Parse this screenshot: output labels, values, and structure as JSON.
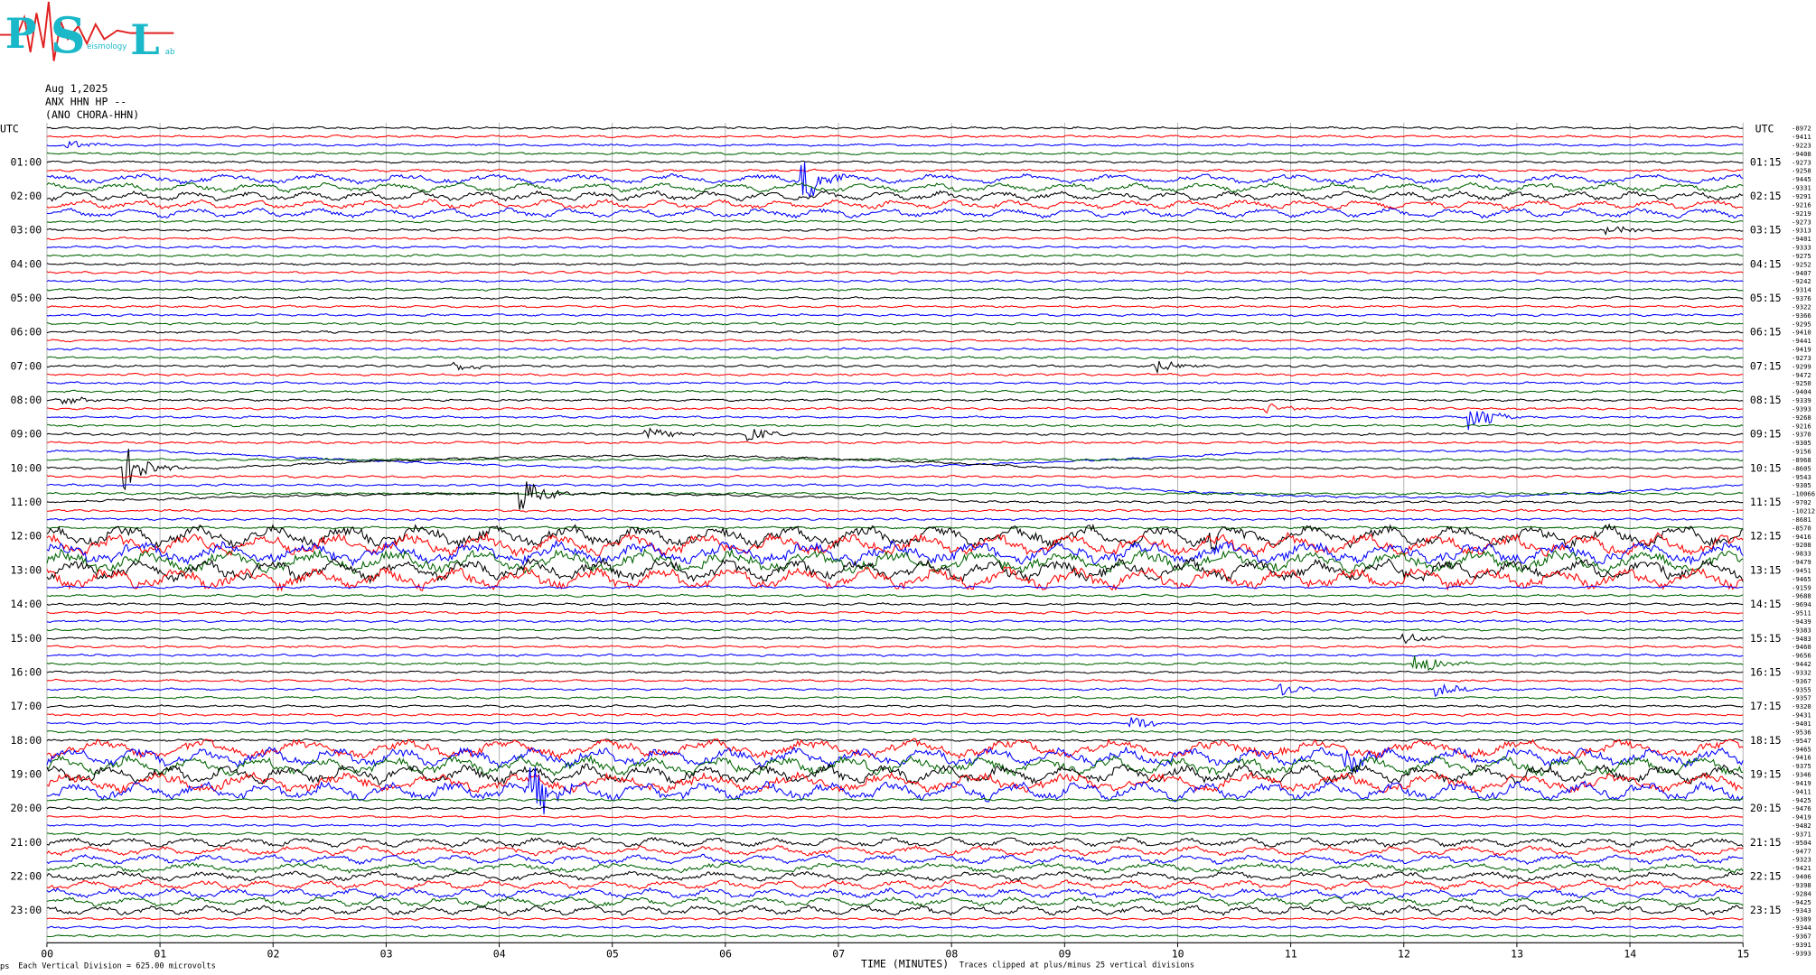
{
  "header": {
    "date": "Aug 1,2025",
    "station": "ANX HHN HP --",
    "location": "(ANO CHORA-HHN)"
  },
  "logo": {
    "letters": [
      "P",
      "S",
      "L"
    ],
    "words": [
      "eismology",
      "ab"
    ],
    "color": "#1ab8c8",
    "wave_color": "#e02020"
  },
  "footer": {
    "scale": "Each Vertical Division =  625.00 microvolts",
    "xlabel": "TIME (MINUTES)",
    "clip_note": "Traces clipped at plus/minus 25 vertical divisions",
    "corner": "ps"
  },
  "chart_data": {
    "type": "line",
    "title": "ANX HHN HP --",
    "xlabel": "TIME (MINUTES)",
    "x_ticks": [
      "00",
      "01",
      "02",
      "03",
      "04",
      "05",
      "06",
      "07",
      "08",
      "09",
      "10",
      "11",
      "12",
      "13",
      "14",
      "15"
    ],
    "xlim": [
      0,
      15
    ],
    "axis_left_label": "UTC",
    "axis_right_label": "UTC",
    "hours_left": [
      "01:00",
      "02:00",
      "03:00",
      "04:00",
      "05:00",
      "06:00",
      "07:00",
      "08:00",
      "09:00",
      "10:00",
      "11:00",
      "12:00",
      "13:00",
      "14:00",
      "15:00",
      "16:00",
      "17:00",
      "18:00",
      "19:00",
      "20:00",
      "21:00",
      "22:00",
      "23:00"
    ],
    "hours_right": [
      "01:15",
      "02:15",
      "03:15",
      "04:15",
      "05:15",
      "06:15",
      "07:15",
      "08:15",
      "09:15",
      "10:15",
      "11:15",
      "12:15",
      "13:15",
      "14:15",
      "15:15",
      "16:15",
      "17:15",
      "18:15",
      "19:15",
      "20:15",
      "21:15",
      "22:15",
      "23:15"
    ],
    "trace_colors": [
      "#000000",
      "#ff0000",
      "#0000ff",
      "#006400"
    ],
    "trace_count": 96,
    "trace_minutes": 15,
    "right_values": [
      "-8972",
      "-9411",
      "-9223",
      "-9408",
      "-9273",
      "-9258",
      "-9445",
      "-9331",
      "-9291",
      "-9216",
      "-9219",
      "-9273",
      "-9313",
      "-9401",
      "-9333",
      "-9275",
      "-9252",
      "-9407",
      "-9242",
      "-9314",
      "-9376",
      "-9322",
      "-9366",
      "-9295",
      "-9410",
      "-9441",
      "-9419",
      "-9273",
      "-9299",
      "-9472",
      "-9250",
      "-9404",
      "-9339",
      "-9393",
      "-9268",
      "-9216",
      "-9370",
      "-9305",
      "-9156",
      "-8968",
      "-8605",
      "-9543",
      "-9305",
      "-10066",
      "-9702",
      "-10212",
      "-8681",
      "-8570",
      "-9416",
      "-9208",
      "-9833",
      "-9479",
      "-9451",
      "-9465",
      "-9159",
      "-9688",
      "-9694",
      "-9511",
      "-9439",
      "-9383",
      "-9483",
      "-9460",
      "-9656",
      "-9442",
      "-9332",
      "-9367",
      "-9355",
      "-9357",
      "-9320",
      "-9431",
      "-9401",
      "-9536",
      "-9547",
      "-9465",
      "-9416",
      "-9375",
      "-9346",
      "-9419",
      "-9411",
      "-9425",
      "-9476",
      "-9419",
      "-9482",
      "-9371",
      "-9504",
      "-9477",
      "-9323",
      "-9421",
      "-9406",
      "-9398",
      "-9284",
      "-9425",
      "-9343",
      "-9389",
      "-9344",
      "-9367",
      "-9391",
      "-9393"
    ],
    "events": [
      {
        "trace": 2,
        "minute": 0.2,
        "kind": "burst",
        "strength": 0.6
      },
      {
        "trace": 6,
        "minute": 6.7,
        "kind": "burst",
        "strength": 2.4
      },
      {
        "trace": 12,
        "minute": 13.8,
        "kind": "burst",
        "strength": 0.7
      },
      {
        "trace": 28,
        "minute": 3.6,
        "kind": "burst",
        "strength": 0.8
      },
      {
        "trace": 28,
        "minute": 9.8,
        "kind": "burst",
        "strength": 1.0
      },
      {
        "trace": 32,
        "minute": 0.15,
        "kind": "burst",
        "strength": 0.6
      },
      {
        "trace": 33,
        "minute": 10.8,
        "kind": "burst",
        "strength": 0.8
      },
      {
        "trace": 34,
        "minute": 12.6,
        "kind": "burst",
        "strength": 1.8
      },
      {
        "trace": 36,
        "minute": 5.3,
        "kind": "burst",
        "strength": 1.0
      },
      {
        "trace": 36,
        "minute": 6.2,
        "kind": "burst",
        "strength": 1.0
      },
      {
        "trace": 40,
        "minute": 0.7,
        "kind": "burst",
        "strength": 2.6
      },
      {
        "trace": 44,
        "minute": 4.2,
        "kind": "burst",
        "strength": 2.2
      },
      {
        "trace": 48,
        "minute": 10.3,
        "kind": "burst",
        "strength": 1.2
      },
      {
        "trace": 60,
        "minute": 12.0,
        "kind": "burst",
        "strength": 0.8
      },
      {
        "trace": 63,
        "minute": 12.1,
        "kind": "burst",
        "strength": 1.6
      },
      {
        "trace": 66,
        "minute": 10.9,
        "kind": "burst",
        "strength": 0.9
      },
      {
        "trace": 66,
        "minute": 12.3,
        "kind": "burst",
        "strength": 0.8
      },
      {
        "trace": 70,
        "minute": 9.6,
        "kind": "burst",
        "strength": 0.9
      },
      {
        "trace": 74,
        "minute": 11.5,
        "kind": "burst",
        "strength": 1.5
      },
      {
        "trace": 78,
        "minute": 4.3,
        "kind": "burst",
        "strength": 3.0
      }
    ],
    "drifts": [
      {
        "trace": 38,
        "from": 1.0,
        "to": 11.0,
        "shape": "bow",
        "amp": 20
      },
      {
        "trace": 40,
        "from": 1.5,
        "to": 9.0,
        "shape": "bow",
        "amp": -14
      },
      {
        "trace": 42,
        "from": 9.0,
        "to": 15.0,
        "shape": "bow",
        "amp": 14
      },
      {
        "trace": 44,
        "from": 0.0,
        "to": 8.5,
        "shape": "bow",
        "amp": -10
      }
    ],
    "active_bands": [
      {
        "from": 48,
        "to": 53,
        "amp": 14
      },
      {
        "from": 73,
        "to": 78,
        "amp": 12
      },
      {
        "from": 6,
        "to": 10,
        "amp": 6
      },
      {
        "from": 84,
        "to": 92,
        "amp": 6
      }
    ]
  }
}
